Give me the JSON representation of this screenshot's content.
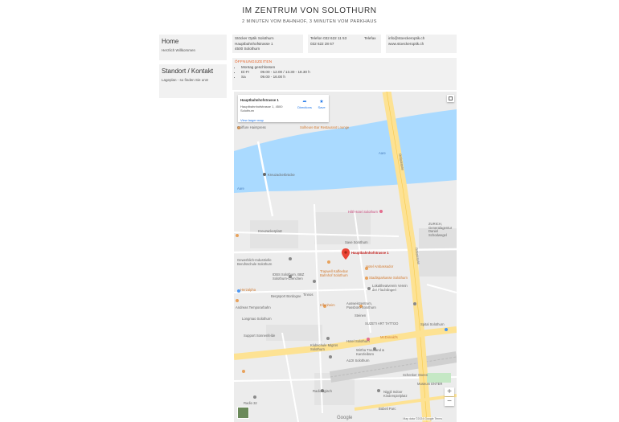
{
  "header": {
    "title": "IM ZENTRUM VON SOLOTHURN",
    "subtitle": "2 MINUTEN VOM BAHNHOF, 3 MINUTEN VOM PARKHAUS"
  },
  "sidebar": {
    "items": [
      {
        "label": "Home",
        "sub": "Herzlich Willkommen"
      },
      {
        "label": "Standort / Kontakt",
        "sub": "Lageplan - so finden Sie uns!"
      }
    ]
  },
  "contact": {
    "name": "Stöcker Optik Solothurn",
    "street": "Hauptbahnhofstrasse 1",
    "city": "4500 Solothurn",
    "phone_label": "Telefon",
    "phone": "032 622 11 53",
    "phone2": "032 622 28 67",
    "fax_label": "Telefax",
    "email": "info@stoeckeroptik.ch",
    "web": "www.stoeckeroptik.ch"
  },
  "hours": {
    "heading": "ÖFFNUNGSZEITEN",
    "rows": [
      {
        "day": "Montag geschlossen",
        "time": ""
      },
      {
        "day": "Di-Fr",
        "time": "09.00 - 12.00 / 13.30 - 18.30 h"
      },
      {
        "day": "Sa",
        "time": "09.00 - 16.00 h"
      }
    ]
  },
  "map": {
    "card_title": "Hauptbahnhofstrasse 1",
    "card_address": "Hauptbahnhofstrasse 1, 4500 Solothurn",
    "card_link": "View larger map",
    "directions_label": "Directions",
    "save_label": "Save",
    "pin_label": "Hauptbahnhofstrasse 1",
    "labels": {
      "coiffure": "Coiffure Hairspress",
      "solheure": "Solheure Bar Restaurant Lounge",
      "kreuzacker": "Kreuzackerbrücke",
      "aare1": "Aare",
      "aare2": "Aare",
      "rotistrasse1": "Rötistrasse",
      "rotistrasse2": "Rötistrasse",
      "hiltl": "Hiltl Hotel Solothurn",
      "kreuzackerplatz": "Kreuzackerplatz",
      "zurich": "ZURICH, Generalagentur Daniel Schodwegel",
      "save": "Save Solothurn",
      "gewerblich": "Gewerblich-Industrielle Berufsschule Solothurn",
      "hotel_ambassador": "Hotel Ambassador",
      "bahnhof_cafe": "Trapwell Kaffeebar Bahnhof Solothurn",
      "stadt": "Stadtsparkasse Solothurn",
      "idbs": "IDBS Solothurn, BBZ Solothurn-Grenchen",
      "lokal": "Lokaltheatverein Verein der Flüchtlingen",
      "herzalpha": "Herzalpha",
      "bergsport": "Bergsport Bordogne",
      "tinnos": "Tinnos",
      "elfenheim": "Elfenheim",
      "ausweis": "Ausweiszentrum, Passbüro Solothurn",
      "andreas": "Andreas Temporarbahn",
      "steinen": "Steinen",
      "longmao": "Longmao Solothurn",
      "suzeti": "SUZETI ART TATTOO",
      "support": "Support Sonnenfelde",
      "klub": "Klubschule Migros Solothurn",
      "hotel_sol": "Hotel Solothurn",
      "mcd": "McDonald's",
      "spital": "Spital Solothurn",
      "wirthamac": "Wirtha Treuhand & Kanzleibüro",
      "aldi": "ALDI Solothurn",
      "radio": "Radio 32",
      "radiologie": "Radiologisch",
      "schenker": "Schenker Storen",
      "museum": "Museum ENTER",
      "niggli": "Niggli Indoor Kinderspielplatz",
      "buebe": "Bübeli Parc",
      "google": "Google",
      "copyright": "Map data ©2024 Google  Terms"
    }
  },
  "colors": {
    "accent_orange": "#e55a1c",
    "water": "#aadaff",
    "major_road": "#fde293",
    "pin": "#ea4335"
  }
}
